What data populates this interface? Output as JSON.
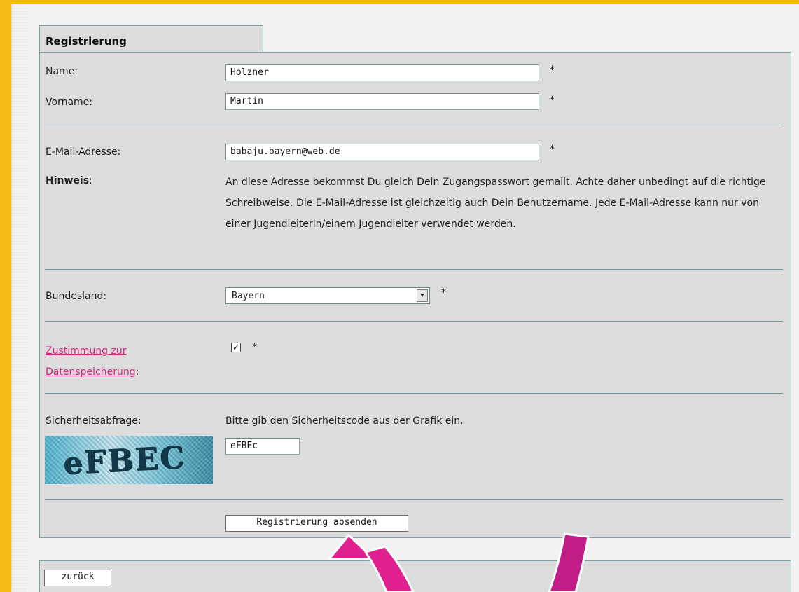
{
  "form": {
    "tab_title": "Registrierung",
    "name_label": "Name:",
    "name_value": "Holzner",
    "firstname_label": "Vorname:",
    "firstname_value": "Martin",
    "email_label": "E-Mail-Adresse:",
    "email_value": "babaju.bayern@web.de",
    "hint_label": "Hinweis",
    "hint_colon": ":",
    "hint_text": "An diese Adresse bekommst Du gleich Dein Zugangspasswort gemailt. Achte daher unbedingt auf die richtige Schreibweise. Die E-Mail-Adresse ist gleichzeitig auch Dein Benutzername. Jede E-Mail-Adresse kann nur von einer Jugendleiterin/einem Jugendleiter verwendet werden.",
    "state_label": "Bundesland:",
    "state_value": "Bayern",
    "consent_link_line1": "Zustimmung zur",
    "consent_link_line2": "Datenspeicherung",
    "consent_colon": ":",
    "consent_checked": true,
    "required_marker": "*",
    "captcha_label": "Sicherheitsabfrage:",
    "captcha_instruction": "Bitte gib den Sicherheitscode aus der Grafik ein.",
    "captcha_image_text": "eFBEC",
    "captcha_value": "eFBEc",
    "submit_label": "Registrierung absenden"
  },
  "footer": {
    "back_label": "zurück"
  },
  "colors": {
    "background_yellow": "#f3bc16",
    "panel_gray": "#dcdcdc",
    "border_teal": "#7aa3a5",
    "link_pink": "#d6237e",
    "arrow_left": "#e1208f",
    "arrow_right": "#c01e86"
  }
}
